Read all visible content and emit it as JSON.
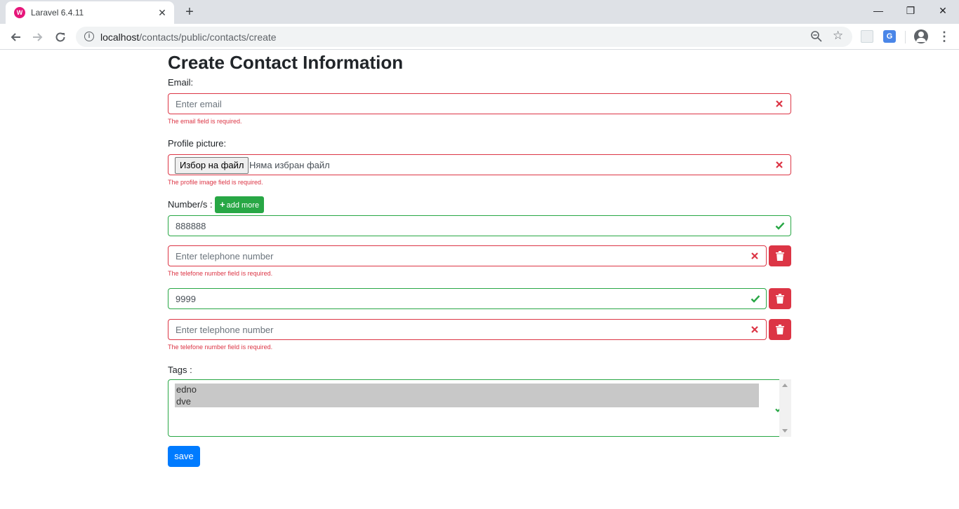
{
  "browser": {
    "tab_title": "Laravel 6.4.11",
    "tab_favicon": "W",
    "tab_close": "✕",
    "new_tab": "+",
    "url_host": "localhost",
    "url_path": "/contacts/public/contacts/create",
    "window_controls": {
      "minimize": "—",
      "maximize": "❐",
      "close": "✕"
    },
    "translate_ext": "G"
  },
  "form": {
    "title": "Create Contact Information",
    "email": {
      "label": "Email:",
      "placeholder": "Enter email",
      "error": "The email field is required."
    },
    "profile": {
      "label": "Profile picture:",
      "button": "Избор на файл",
      "no_file": "Няма избран файл",
      "error": "The profile image field is required."
    },
    "numbers": {
      "label": "Number/s :",
      "add_more": "add more",
      "add_more_icon": "+",
      "items": [
        {
          "value": "888888",
          "placeholder": "Enter telephone number",
          "state": "valid"
        },
        {
          "value": "",
          "placeholder": "Enter telephone number",
          "state": "invalid",
          "error": "The telefone number field is required."
        },
        {
          "value": "9999",
          "placeholder": "Enter telephone number",
          "state": "valid"
        },
        {
          "value": "",
          "placeholder": "Enter telephone number",
          "state": "invalid",
          "error": "The telefone number field is required."
        }
      ]
    },
    "tags": {
      "label": "Tags :",
      "options": [
        "edno",
        "dve"
      ],
      "selected": [
        "edno",
        "dve"
      ]
    },
    "save_label": "save"
  },
  "colors": {
    "invalid": "#dc3545",
    "valid": "#28a745",
    "primary": "#007bff",
    "add_more": "#28a745"
  }
}
